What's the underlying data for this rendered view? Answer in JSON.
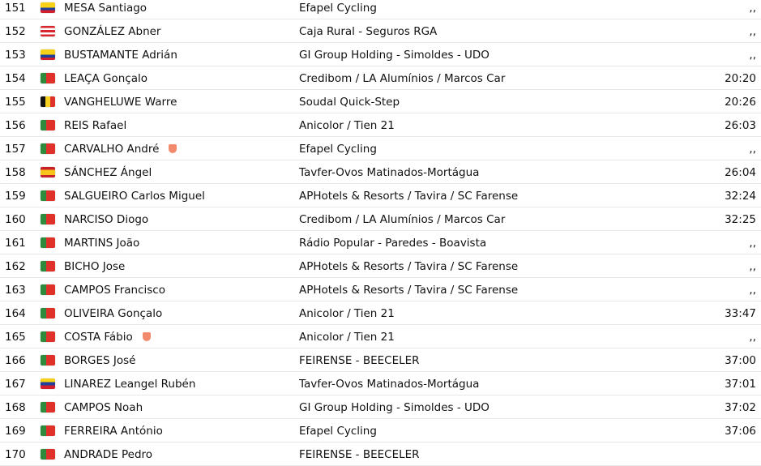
{
  "flag_colors": {
    "colombia": "linear-gradient(#f7d117 0 50%,#1e3f9a 50% 75%,#d21f2d 75%)",
    "puerto-rico": "linear-gradient(#d8262e 0 20%,#fff 20% 40%,#d8262e 40% 60%,#fff 60% 80%,#d8262e 80%)",
    "portugal": "linear-gradient(90deg,#2e8b3e 0 40%,#e0302a 40%)",
    "belgium": "linear-gradient(90deg,#111 0 33%,#f5d020 33% 66%,#e0302a 66%)",
    "spain": "linear-gradient(#c8202a 0 25%,#f7c31c 25% 75%,#c8202a 75%)",
    "venezuela": "linear-gradient(#f7d117 0 33%,#1e3f9a 33% 66%,#d21f2d 66%)"
  },
  "shield_color": "#f28a6e",
  "rows": [
    {
      "pos": "151",
      "flag": "colombia",
      "name": "MESA Santiago",
      "team": "Efapel Cycling",
      "time": ",,"
    },
    {
      "pos": "152",
      "flag": "puerto-rico",
      "name": "GONZÁLEZ Abner",
      "team": "Caja Rural - Seguros RGA",
      "time": ",,"
    },
    {
      "pos": "153",
      "flag": "colombia",
      "name": "BUSTAMANTE Adrián",
      "team": "GI Group Holding - Simoldes - UDO",
      "time": ",,"
    },
    {
      "pos": "154",
      "flag": "portugal",
      "name": "LEAÇA Gonçalo",
      "team": "Credibom / LA Alumínios / Marcos Car",
      "time": "20:20"
    },
    {
      "pos": "155",
      "flag": "belgium",
      "name": "VANGHELUWE Warre",
      "team": "Soudal Quick-Step",
      "time": "20:26"
    },
    {
      "pos": "156",
      "flag": "portugal",
      "name": "REIS Rafael",
      "team": "Anicolor / Tien 21",
      "time": "26:03"
    },
    {
      "pos": "157",
      "flag": "portugal",
      "name": "CARVALHO André",
      "shield": true,
      "team": "Efapel Cycling",
      "time": ",,"
    },
    {
      "pos": "158",
      "flag": "spain",
      "name": "SÁNCHEZ Ángel",
      "team": "Tavfer-Ovos Matinados-Mortágua",
      "time": "26:04"
    },
    {
      "pos": "159",
      "flag": "portugal",
      "name": "SALGUEIRO Carlos Miguel",
      "team": "APHotels & Resorts / Tavira / SC Farense",
      "time": "32:24"
    },
    {
      "pos": "160",
      "flag": "portugal",
      "name": "NARCISO Diogo",
      "team": "Credibom / LA Alumínios / Marcos Car",
      "time": "32:25"
    },
    {
      "pos": "161",
      "flag": "portugal",
      "name": "MARTINS João",
      "team": "Rádio Popular - Paredes - Boavista",
      "time": ",,"
    },
    {
      "pos": "162",
      "flag": "portugal",
      "name": "BICHO Jose",
      "team": "APHotels & Resorts / Tavira / SC Farense",
      "time": ",,"
    },
    {
      "pos": "163",
      "flag": "portugal",
      "name": "CAMPOS Francisco",
      "team": "APHotels & Resorts / Tavira / SC Farense",
      "time": ",,"
    },
    {
      "pos": "164",
      "flag": "portugal",
      "name": "OLIVEIRA Gonçalo",
      "team": "Anicolor / Tien 21",
      "time": "33:47"
    },
    {
      "pos": "165",
      "flag": "portugal",
      "name": "COSTA Fábio",
      "shield": true,
      "team": "Anicolor / Tien 21",
      "time": ",,"
    },
    {
      "pos": "166",
      "flag": "portugal",
      "name": "BORGES José",
      "team": "FEIRENSE - BEECELER",
      "time": "37:00"
    },
    {
      "pos": "167",
      "flag": "venezuela",
      "name": "LINAREZ Leangel Rubén",
      "team": "Tavfer-Ovos Matinados-Mortágua",
      "time": "37:01"
    },
    {
      "pos": "168",
      "flag": "portugal",
      "name": "CAMPOS Noah",
      "team": "GI Group Holding - Simoldes - UDO",
      "time": "37:02"
    },
    {
      "pos": "169",
      "flag": "portugal",
      "name": "FERREIRA António",
      "team": "Efapel Cycling",
      "time": "37:06"
    },
    {
      "pos": "170",
      "flag": "portugal",
      "name": "ANDRADE Pedro",
      "team": "FEIRENSE - BEECELER",
      "time": ""
    }
  ]
}
